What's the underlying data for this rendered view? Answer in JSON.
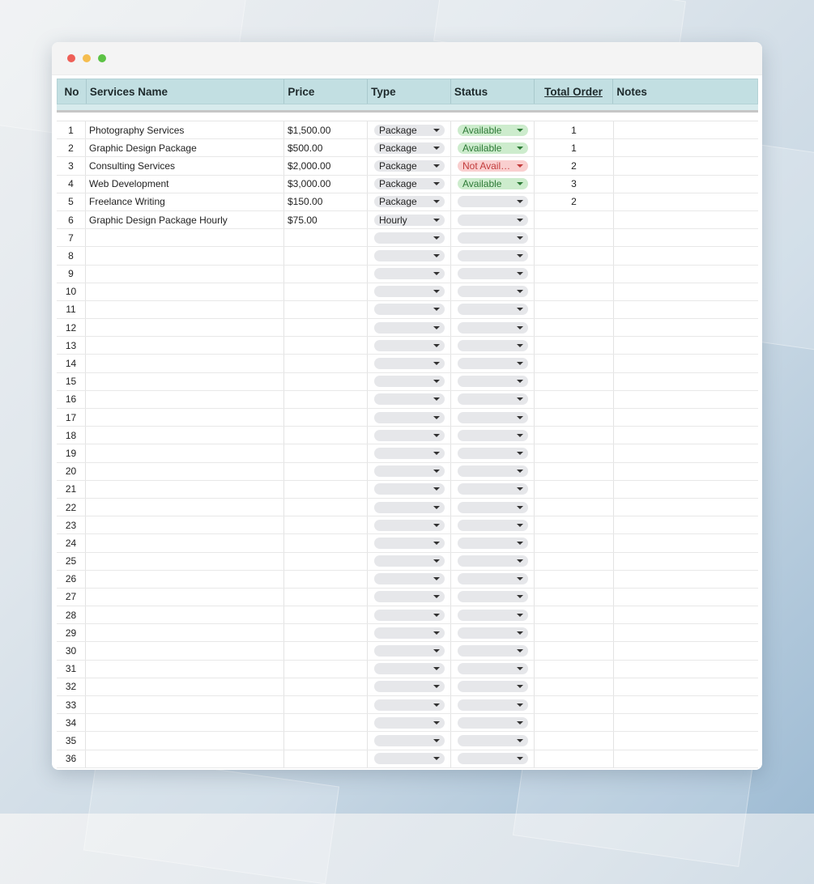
{
  "window": {
    "controls": [
      "close-dot",
      "minimize-dot",
      "maximize-dot"
    ]
  },
  "table": {
    "headers": {
      "no": "No",
      "name": "Services Name",
      "price": "Price",
      "type": "Type",
      "status": "Status",
      "total_order": "Total Order",
      "notes": "Notes"
    },
    "rows": [
      {
        "no": "1",
        "name": "Photography Services",
        "price": "$1,500.00",
        "type": "Package",
        "status": "Available",
        "total_order": "1",
        "notes": ""
      },
      {
        "no": "2",
        "name": "Graphic Design Package",
        "price": "$500.00",
        "type": "Package",
        "status": "Available",
        "total_order": "1",
        "notes": ""
      },
      {
        "no": "3",
        "name": "Consulting Services",
        "price": "$2,000.00",
        "type": "Package",
        "status": "Not Availa...",
        "total_order": "2",
        "notes": ""
      },
      {
        "no": "4",
        "name": "Web Development",
        "price": "$3,000.00",
        "type": "Package",
        "status": "Available",
        "total_order": "3",
        "notes": ""
      },
      {
        "no": "5",
        "name": "Freelance Writing",
        "price": "$150.00",
        "type": "Package",
        "status": "",
        "total_order": "2",
        "notes": ""
      },
      {
        "no": "6",
        "name": "Graphic Design Package Hourly",
        "price": "$75.00",
        "type": "Hourly",
        "status": "",
        "total_order": "",
        "notes": ""
      },
      {
        "no": "7",
        "name": "",
        "price": "",
        "type": "",
        "status": "",
        "total_order": "",
        "notes": ""
      },
      {
        "no": "8",
        "name": "",
        "price": "",
        "type": "",
        "status": "",
        "total_order": "",
        "notes": ""
      },
      {
        "no": "9",
        "name": "",
        "price": "",
        "type": "",
        "status": "",
        "total_order": "",
        "notes": ""
      },
      {
        "no": "10",
        "name": "",
        "price": "",
        "type": "",
        "status": "",
        "total_order": "",
        "notes": ""
      },
      {
        "no": "11",
        "name": "",
        "price": "",
        "type": "",
        "status": "",
        "total_order": "",
        "notes": ""
      },
      {
        "no": "12",
        "name": "",
        "price": "",
        "type": "",
        "status": "",
        "total_order": "",
        "notes": ""
      },
      {
        "no": "13",
        "name": "",
        "price": "",
        "type": "",
        "status": "",
        "total_order": "",
        "notes": ""
      },
      {
        "no": "14",
        "name": "",
        "price": "",
        "type": "",
        "status": "",
        "total_order": "",
        "notes": ""
      },
      {
        "no": "15",
        "name": "",
        "price": "",
        "type": "",
        "status": "",
        "total_order": "",
        "notes": ""
      },
      {
        "no": "16",
        "name": "",
        "price": "",
        "type": "",
        "status": "",
        "total_order": "",
        "notes": ""
      },
      {
        "no": "17",
        "name": "",
        "price": "",
        "type": "",
        "status": "",
        "total_order": "",
        "notes": ""
      },
      {
        "no": "18",
        "name": "",
        "price": "",
        "type": "",
        "status": "",
        "total_order": "",
        "notes": ""
      },
      {
        "no": "19",
        "name": "",
        "price": "",
        "type": "",
        "status": "",
        "total_order": "",
        "notes": ""
      },
      {
        "no": "20",
        "name": "",
        "price": "",
        "type": "",
        "status": "",
        "total_order": "",
        "notes": ""
      },
      {
        "no": "21",
        "name": "",
        "price": "",
        "type": "",
        "status": "",
        "total_order": "",
        "notes": ""
      },
      {
        "no": "22",
        "name": "",
        "price": "",
        "type": "",
        "status": "",
        "total_order": "",
        "notes": ""
      },
      {
        "no": "23",
        "name": "",
        "price": "",
        "type": "",
        "status": "",
        "total_order": "",
        "notes": ""
      },
      {
        "no": "24",
        "name": "",
        "price": "",
        "type": "",
        "status": "",
        "total_order": "",
        "notes": ""
      },
      {
        "no": "25",
        "name": "",
        "price": "",
        "type": "",
        "status": "",
        "total_order": "",
        "notes": ""
      },
      {
        "no": "26",
        "name": "",
        "price": "",
        "type": "",
        "status": "",
        "total_order": "",
        "notes": ""
      },
      {
        "no": "27",
        "name": "",
        "price": "",
        "type": "",
        "status": "",
        "total_order": "",
        "notes": ""
      },
      {
        "no": "28",
        "name": "",
        "price": "",
        "type": "",
        "status": "",
        "total_order": "",
        "notes": ""
      },
      {
        "no": "29",
        "name": "",
        "price": "",
        "type": "",
        "status": "",
        "total_order": "",
        "notes": ""
      },
      {
        "no": "30",
        "name": "",
        "price": "",
        "type": "",
        "status": "",
        "total_order": "",
        "notes": ""
      },
      {
        "no": "31",
        "name": "",
        "price": "",
        "type": "",
        "status": "",
        "total_order": "",
        "notes": ""
      },
      {
        "no": "32",
        "name": "",
        "price": "",
        "type": "",
        "status": "",
        "total_order": "",
        "notes": ""
      },
      {
        "no": "33",
        "name": "",
        "price": "",
        "type": "",
        "status": "",
        "total_order": "",
        "notes": ""
      },
      {
        "no": "34",
        "name": "",
        "price": "",
        "type": "",
        "status": "",
        "total_order": "",
        "notes": ""
      },
      {
        "no": "35",
        "name": "",
        "price": "",
        "type": "",
        "status": "",
        "total_order": "",
        "notes": ""
      },
      {
        "no": "36",
        "name": "",
        "price": "",
        "type": "",
        "status": "",
        "total_order": "",
        "notes": ""
      }
    ]
  },
  "colors": {
    "header_bg": "#c2dfe2",
    "available_bg": "#cdeccd",
    "available_text": "#2d7a36",
    "not_available_bg": "#f9cfcf",
    "not_available_text": "#c23b3b",
    "chip_empty_bg": "#e6e7ea"
  }
}
